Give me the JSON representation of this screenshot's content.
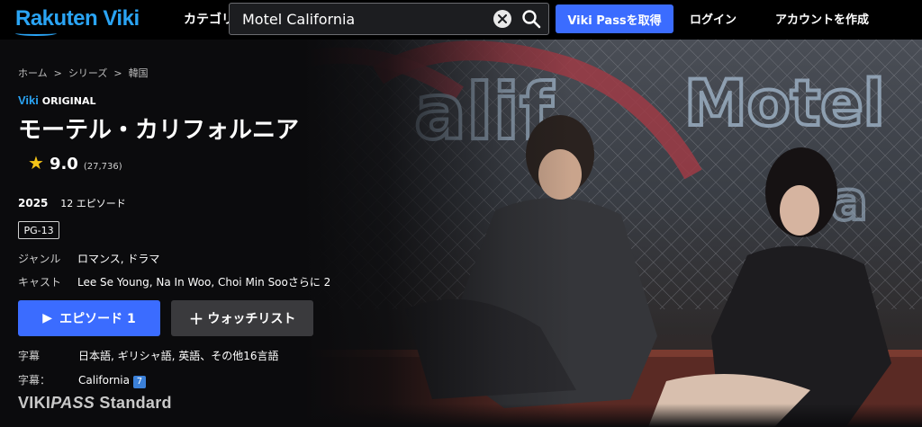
{
  "header": {
    "logo": "Rakuten Viki",
    "category_label": "カテゴリー",
    "search": {
      "value": "Motel California",
      "placeholder": ""
    },
    "vikipass_button": "Viki Passを取得",
    "login": "ログイン",
    "signup": "アカウントを作成"
  },
  "breadcrumb": [
    "ホーム",
    ">",
    "シリーズ",
    ">",
    "韓国"
  ],
  "show": {
    "badge_brand": "Viki",
    "badge_label": "ORIGINAL",
    "title": "モーテル・カリフォルニア",
    "rating": "9.0",
    "rating_count": "(27,736)",
    "year": "2025",
    "episodes": "12 エピソード",
    "age_rating": "PG-13",
    "genre_label": "ジャンル",
    "genres": "ロマンス, ドラマ",
    "cast_label": "キャスト",
    "cast": "Lee Se Young, Na In Woo, Choi Min Sooさらに 2"
  },
  "actions": {
    "episode_button": "エピソード 1",
    "watchlist_button": "ウォッチリスト"
  },
  "subtitles": {
    "label": "字幕",
    "languages": "日本語, ギリシャ語, 英語、その他16言語",
    "label2": "字幕：",
    "track": "California",
    "track_badge": "7"
  },
  "plan": {
    "name_a": "VIKI",
    "name_b": "PASS",
    "name_c": " Standard"
  },
  "colors": {
    "accent": "#3b6cff",
    "logo": "#2aa4f4",
    "star": "#f5c518",
    "background": "#0b0b0d"
  }
}
